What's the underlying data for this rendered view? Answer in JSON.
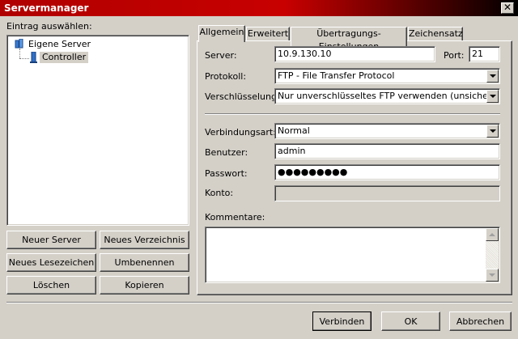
{
  "window": {
    "title": "Servermanager",
    "close_glyph": "✕"
  },
  "left": {
    "label": "Eintrag auswählen:",
    "tree": {
      "root_label": "Eigene Server",
      "root_icon": "server-folder-icon",
      "child_label": "Controller",
      "child_icon": "server-icon"
    },
    "buttons": {
      "new_server": "Neuer Server",
      "new_folder": "Neues Verzeichnis",
      "new_bookmark": "Neues Lesezeichen",
      "rename": "Umbenennen",
      "delete": "Löschen",
      "copy": "Kopieren"
    }
  },
  "tabs": [
    {
      "label": "Allgemein",
      "active": true
    },
    {
      "label": "Erweitert",
      "active": false
    },
    {
      "label": "Übertragungs-Einstellungen",
      "active": false
    },
    {
      "label": "Zeichensatz",
      "active": false
    }
  ],
  "general": {
    "server_label": "Server:",
    "server_value": "10.9.130.10",
    "port_label": "Port:",
    "port_value": "21",
    "protocol_label": "Protokoll:",
    "protocol_value": "FTP - File Transfer Protocol",
    "encryption_label": "Verschlüsselung:",
    "encryption_value": "Nur unverschlüsseltes FTP verwenden (unsicher)",
    "logontype_label": "Verbindungsart:",
    "logontype_value": "Normal",
    "user_label": "Benutzer:",
    "user_value": "admin",
    "password_label": "Passwort:",
    "password_value": "●●●●●●●●●",
    "account_label": "Konto:",
    "account_value": "",
    "comments_label": "Kommentare:",
    "comments_value": ""
  },
  "footer": {
    "connect": "Verbinden",
    "ok": "OK",
    "cancel": "Abbrechen"
  }
}
